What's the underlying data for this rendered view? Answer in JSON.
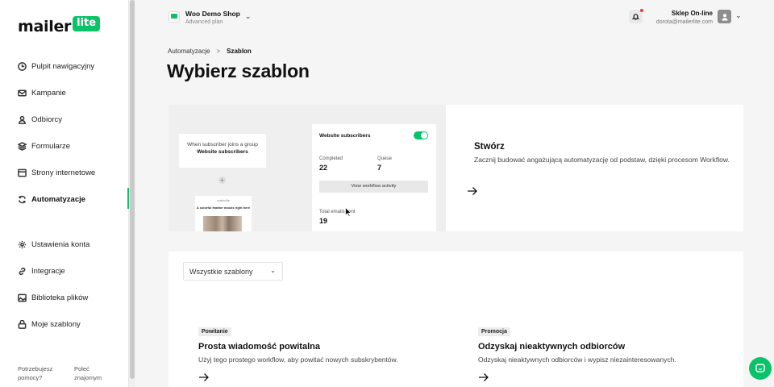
{
  "brand": {
    "logo_text": "mailer",
    "logo_badge": "lite",
    "accent": "#09c269"
  },
  "sidebar": {
    "items": [
      {
        "label": "Pulpit nawigacyjny",
        "icon": "dashboard-icon"
      },
      {
        "label": "Kampanie",
        "icon": "mail-icon"
      },
      {
        "label": "Odbiorcy",
        "icon": "user-icon"
      },
      {
        "label": "Formularze",
        "icon": "layers-icon"
      },
      {
        "label": "Strony internetowe",
        "icon": "browser-icon"
      },
      {
        "label": "Automatyzacje",
        "icon": "refresh-icon",
        "active": true
      }
    ],
    "bottom_items": [
      {
        "label": "Ustawienia konta",
        "icon": "gear-icon"
      },
      {
        "label": "Integracje",
        "icon": "link-icon"
      },
      {
        "label": "Biblioteka plików",
        "icon": "image-icon"
      },
      {
        "label": "Moje szablony",
        "icon": "template-icon"
      }
    ],
    "help": [
      "Potrzebujesz pomocy?",
      "Poleć znajomym"
    ]
  },
  "topbar": {
    "shop_name": "Woo Demo Shop",
    "shop_plan": "Advanced plan",
    "account_name": "Sklep On-line",
    "account_email": "dorota@mailerlite.com"
  },
  "breadcrumb": {
    "parent": "Automatyzacje",
    "separator": ">",
    "current": "Szablon"
  },
  "page_title": "Wybierz szablon",
  "create_card": {
    "title": "Stwórz",
    "description": "Zacznij budować angażującą automatyzację od podstaw, dzięki procesom Workflow.",
    "preview": {
      "trigger_prefix": "When subscriber joins a group",
      "trigger_bold": "Website subscribers",
      "email_brand": "mailerlite",
      "email_headline": "A colorful feather mocks right here",
      "panel_title": "Website subscribers",
      "completed_label": "Completed",
      "completed_value": "22",
      "queue_label": "Queue",
      "queue_value": "7",
      "button_label": "View workflow activity",
      "total_label": "Total emails sent",
      "total_value": "19"
    }
  },
  "templates": {
    "filter_label": "Wszystkie szablony",
    "items": [
      {
        "tag": "Powitanie",
        "title": "Prosta wiadomość powitalna",
        "description": "Użyj tego prostego workflow, aby powitać nowych subskrybentów."
      },
      {
        "tag": "Promocja",
        "title": "Odzyskaj nieaktywnych odbiorców",
        "description": "Odzyskaj nieaktywnych odbiorców i wypisz niezainteresowanych."
      }
    ]
  }
}
